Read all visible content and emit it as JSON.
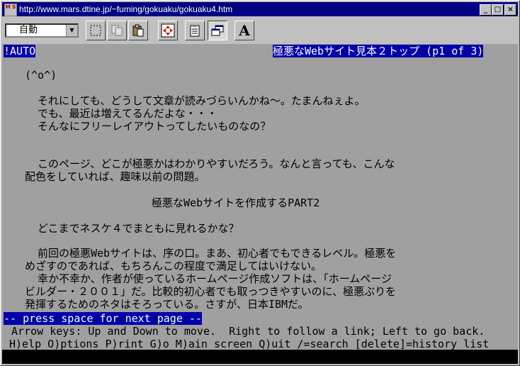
{
  "window": {
    "title": "http://www.mars.dtine.jp/~fuming/gokuaku/gokuaku4.htm",
    "icon_text": "M S"
  },
  "toolbar": {
    "encoding_selected": "自動",
    "font_button_label": "A"
  },
  "terminal": {
    "header_left": "!AUTO",
    "header_right": "極悪なWebサイト見本２トップ (p1 of 3)",
    "lines": [
      "(^o^)",
      "それにしても、どうして文章が読みづらいんかね～。たまんねぇよ。",
      "でも、最近は増えてるんだよな・・・",
      "そんなにフリーレイアウトってしたいものなの？",
      "このページ、どこが極悪かはわかりやすいだろう。なんと言っても、こんな",
      "配色をしていれば、趣味以前の問題。",
      "極悪なWebサイトを作成するPART2",
      "どこまでネスケ４でまともに見れるかな？",
      "前回の極悪Webサイトは、序の口。まあ、初心者でもできるレベル。極悪を",
      "めざすのであれば、もちろんこの程度で満足してはいけない。",
      "幸か不幸か、作者が使っているホームページ作成ソフトは、「ホームページ",
      "ビルダー・２００１」だ。比較的初心者でも取っつきやすいのに、極悪ぶりを",
      "発揮するためのネタはそろっている。さすが、日本IBMだ。"
    ],
    "prompt": "-- press space for next page --",
    "help1": " Arrow keys: Up and Down to move.  Right to follow a link; Left to go back.",
    "help2": "H)elp O)ptions P)rint G)o M)ain screen Q)uit /=search [delete]=history list"
  }
}
